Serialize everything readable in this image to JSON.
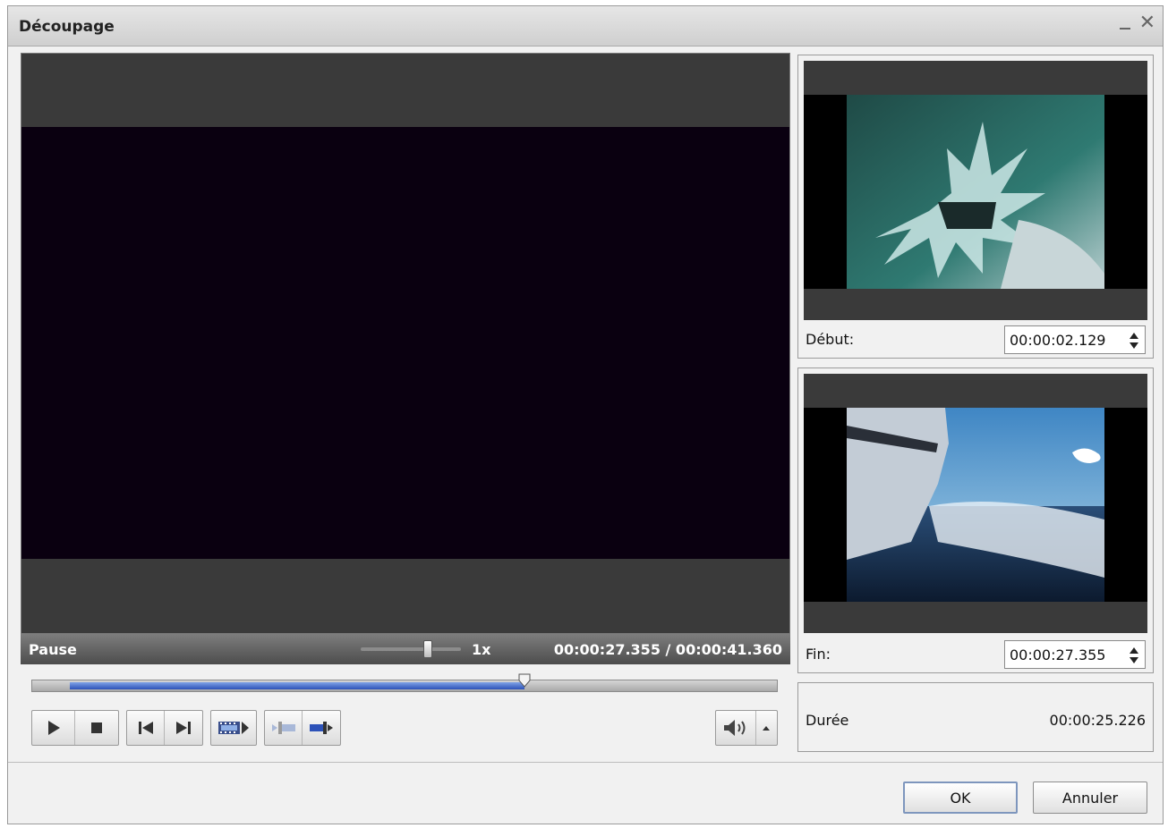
{
  "window": {
    "title": "Découpage"
  },
  "player": {
    "status": "Pause",
    "speed": "1x",
    "time_readout": "00:00:27.355 / 00:00:41.360",
    "timeline": {
      "selection_start_fraction": 0.051,
      "selection_end_fraction": 0.661,
      "playhead_fraction": 0.661
    }
  },
  "controls": [
    {
      "name": "play-button",
      "icon": "play-icon"
    },
    {
      "name": "stop-button",
      "icon": "stop-icon"
    },
    {
      "name": "previous-frame-button",
      "icon": "skip-back-icon"
    },
    {
      "name": "next-frame-button",
      "icon": "skip-forward-icon"
    },
    {
      "name": "play-selection-button",
      "icon": "film-play-icon"
    },
    {
      "name": "set-start-button",
      "icon": "set-start-icon"
    },
    {
      "name": "set-end-button",
      "icon": "set-end-icon"
    },
    {
      "name": "volume-button",
      "icon": "speaker-icon"
    },
    {
      "name": "volume-menu-button",
      "icon": "chevron-up-icon"
    }
  ],
  "start": {
    "label": "Début:",
    "value": "00:00:02.129"
  },
  "end": {
    "label": "Fin:",
    "value": "00:00:27.355"
  },
  "duration": {
    "label": "Durée",
    "value": "00:00:25.226"
  },
  "buttons": {
    "ok": "OK",
    "cancel": "Annuler"
  },
  "colors": {
    "selection": "#2d52b8",
    "video_bg": "#0a0010",
    "frame_bg": "#3a3a3a"
  }
}
